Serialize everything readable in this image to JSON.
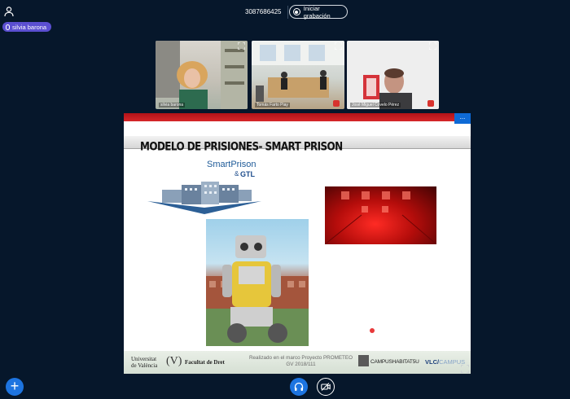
{
  "header": {
    "meeting_id": "3087686425",
    "record_label": "Iniciar grabación",
    "presenter_name": "silvia barona"
  },
  "participants": [
    {
      "name": "silvia barona"
    },
    {
      "name": "Tomás Farto Piay"
    },
    {
      "name": "José Miguel Covelo Pérez"
    }
  ],
  "slide": {
    "title": "MODELO DE PRISIONES- SMART PRISON",
    "brand": "SmartPrison",
    "brand_amp": "&",
    "brand_partner": "GTL",
    "more_label": "...",
    "footer": {
      "university_line1": "Universitat",
      "university_line2": "de València",
      "university_mark": "(V)",
      "faculty": "Facultat de Dret",
      "project_line1": "Realizado en el marco Proyecto PROMETEO",
      "project_line2": "GV 2018/111",
      "campus": "CAMPUSHABITAT5U",
      "vlc_main": "VLC/",
      "vlc_suffix": "CAMPUS"
    }
  },
  "toolbar": {
    "add_label": "+"
  },
  "colors": {
    "background": "#06172b",
    "accent": "#1d74e0",
    "presenter_chip": "#5b4fd1",
    "slide_red": "#d6272a"
  }
}
